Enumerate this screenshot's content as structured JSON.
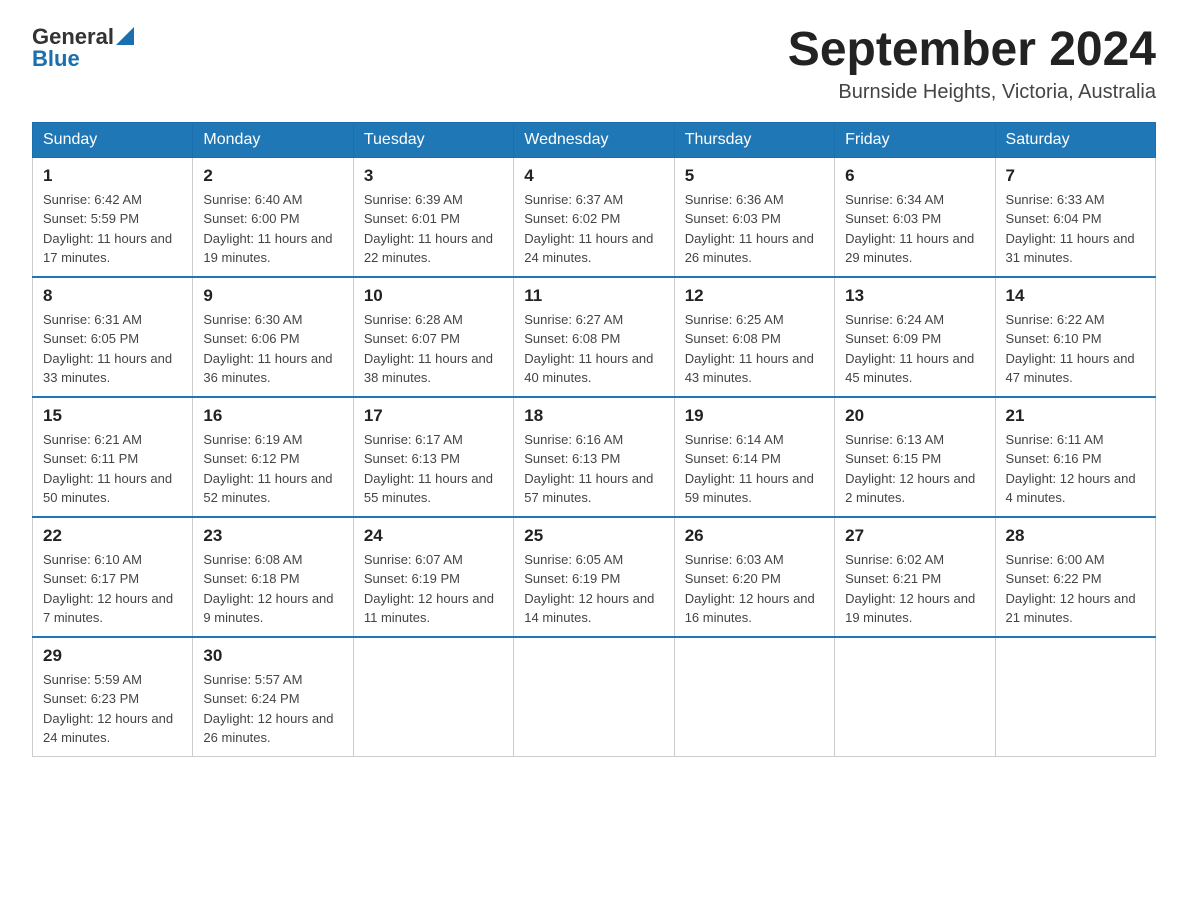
{
  "logo": {
    "general": "General",
    "blue": "Blue"
  },
  "title": "September 2024",
  "location": "Burnside Heights, Victoria, Australia",
  "headers": [
    "Sunday",
    "Monday",
    "Tuesday",
    "Wednesday",
    "Thursday",
    "Friday",
    "Saturday"
  ],
  "weeks": [
    [
      {
        "day": "1",
        "sunrise": "6:42 AM",
        "sunset": "5:59 PM",
        "daylight": "11 hours and 17 minutes."
      },
      {
        "day": "2",
        "sunrise": "6:40 AM",
        "sunset": "6:00 PM",
        "daylight": "11 hours and 19 minutes."
      },
      {
        "day": "3",
        "sunrise": "6:39 AM",
        "sunset": "6:01 PM",
        "daylight": "11 hours and 22 minutes."
      },
      {
        "day": "4",
        "sunrise": "6:37 AM",
        "sunset": "6:02 PM",
        "daylight": "11 hours and 24 minutes."
      },
      {
        "day": "5",
        "sunrise": "6:36 AM",
        "sunset": "6:03 PM",
        "daylight": "11 hours and 26 minutes."
      },
      {
        "day": "6",
        "sunrise": "6:34 AM",
        "sunset": "6:03 PM",
        "daylight": "11 hours and 29 minutes."
      },
      {
        "day": "7",
        "sunrise": "6:33 AM",
        "sunset": "6:04 PM",
        "daylight": "11 hours and 31 minutes."
      }
    ],
    [
      {
        "day": "8",
        "sunrise": "6:31 AM",
        "sunset": "6:05 PM",
        "daylight": "11 hours and 33 minutes."
      },
      {
        "day": "9",
        "sunrise": "6:30 AM",
        "sunset": "6:06 PM",
        "daylight": "11 hours and 36 minutes."
      },
      {
        "day": "10",
        "sunrise": "6:28 AM",
        "sunset": "6:07 PM",
        "daylight": "11 hours and 38 minutes."
      },
      {
        "day": "11",
        "sunrise": "6:27 AM",
        "sunset": "6:08 PM",
        "daylight": "11 hours and 40 minutes."
      },
      {
        "day": "12",
        "sunrise": "6:25 AM",
        "sunset": "6:08 PM",
        "daylight": "11 hours and 43 minutes."
      },
      {
        "day": "13",
        "sunrise": "6:24 AM",
        "sunset": "6:09 PM",
        "daylight": "11 hours and 45 minutes."
      },
      {
        "day": "14",
        "sunrise": "6:22 AM",
        "sunset": "6:10 PM",
        "daylight": "11 hours and 47 minutes."
      }
    ],
    [
      {
        "day": "15",
        "sunrise": "6:21 AM",
        "sunset": "6:11 PM",
        "daylight": "11 hours and 50 minutes."
      },
      {
        "day": "16",
        "sunrise": "6:19 AM",
        "sunset": "6:12 PM",
        "daylight": "11 hours and 52 minutes."
      },
      {
        "day": "17",
        "sunrise": "6:17 AM",
        "sunset": "6:13 PM",
        "daylight": "11 hours and 55 minutes."
      },
      {
        "day": "18",
        "sunrise": "6:16 AM",
        "sunset": "6:13 PM",
        "daylight": "11 hours and 57 minutes."
      },
      {
        "day": "19",
        "sunrise": "6:14 AM",
        "sunset": "6:14 PM",
        "daylight": "11 hours and 59 minutes."
      },
      {
        "day": "20",
        "sunrise": "6:13 AM",
        "sunset": "6:15 PM",
        "daylight": "12 hours and 2 minutes."
      },
      {
        "day": "21",
        "sunrise": "6:11 AM",
        "sunset": "6:16 PM",
        "daylight": "12 hours and 4 minutes."
      }
    ],
    [
      {
        "day": "22",
        "sunrise": "6:10 AM",
        "sunset": "6:17 PM",
        "daylight": "12 hours and 7 minutes."
      },
      {
        "day": "23",
        "sunrise": "6:08 AM",
        "sunset": "6:18 PM",
        "daylight": "12 hours and 9 minutes."
      },
      {
        "day": "24",
        "sunrise": "6:07 AM",
        "sunset": "6:19 PM",
        "daylight": "12 hours and 11 minutes."
      },
      {
        "day": "25",
        "sunrise": "6:05 AM",
        "sunset": "6:19 PM",
        "daylight": "12 hours and 14 minutes."
      },
      {
        "day": "26",
        "sunrise": "6:03 AM",
        "sunset": "6:20 PM",
        "daylight": "12 hours and 16 minutes."
      },
      {
        "day": "27",
        "sunrise": "6:02 AM",
        "sunset": "6:21 PM",
        "daylight": "12 hours and 19 minutes."
      },
      {
        "day": "28",
        "sunrise": "6:00 AM",
        "sunset": "6:22 PM",
        "daylight": "12 hours and 21 minutes."
      }
    ],
    [
      {
        "day": "29",
        "sunrise": "5:59 AM",
        "sunset": "6:23 PM",
        "daylight": "12 hours and 24 minutes."
      },
      {
        "day": "30",
        "sunrise": "5:57 AM",
        "sunset": "6:24 PM",
        "daylight": "12 hours and 26 minutes."
      },
      null,
      null,
      null,
      null,
      null
    ]
  ],
  "labels": {
    "sunrise": "Sunrise: ",
    "sunset": "Sunset: ",
    "daylight": "Daylight: "
  }
}
